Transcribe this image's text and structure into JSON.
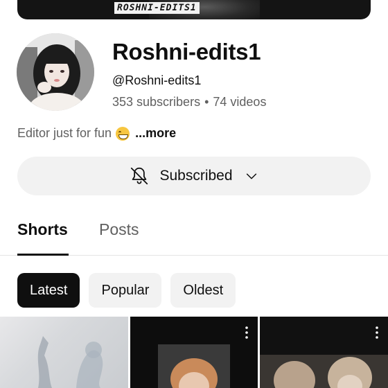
{
  "banner": {
    "text": "ROSHNI-EDITS1"
  },
  "channel": {
    "name": "Roshni-edits1",
    "handle": "@Roshni-edits1",
    "subscribers": "353 subscribers",
    "separator": "•",
    "videos": "74 videos",
    "description": "Editor just for fun",
    "emoji": "grinning-face-emoji",
    "more_label": "...more"
  },
  "subscribe": {
    "label": "Subscribed",
    "bell_icon": "bell-off-icon",
    "chevron_icon": "chevron-down-icon"
  },
  "tabs": [
    {
      "label": "Shorts",
      "active": true
    },
    {
      "label": "Posts",
      "active": false
    }
  ],
  "filters": [
    {
      "label": "Latest",
      "selected": true
    },
    {
      "label": "Popular",
      "selected": false
    },
    {
      "label": "Oldest",
      "selected": false
    }
  ],
  "colors": {
    "text": "#0f0f0f",
    "secondary_text": "#606060",
    "chip_bg": "#f2f2f2",
    "selected_chip_bg": "#0f0f0f"
  },
  "shorts_icons": {
    "menu_icon": "more-vert-icon"
  }
}
